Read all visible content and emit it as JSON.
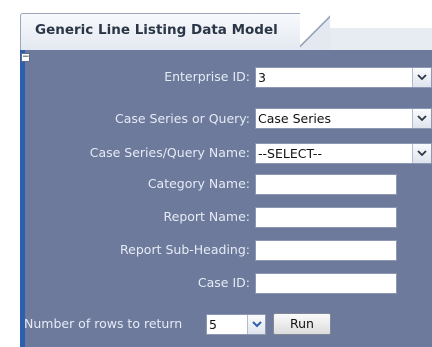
{
  "tab": {
    "title": "Generic Line Listing Data Model"
  },
  "collapse_toggle": "−",
  "fields": {
    "enterprise_id": {
      "label": "Enterprise ID:",
      "value": "3"
    },
    "case_series_or_query": {
      "label": "Case Series or Query:",
      "value": "Case Series"
    },
    "case_series_query_name": {
      "label": "Case Series/Query Name:",
      "value": "--SELECT--"
    },
    "category_name": {
      "label": "Category Name:",
      "value": ""
    },
    "report_name": {
      "label": "Report Name:",
      "value": ""
    },
    "report_sub_heading": {
      "label": "Report Sub-Heading:",
      "value": ""
    },
    "case_id": {
      "label": "Case ID:",
      "value": ""
    }
  },
  "rows_to_return": {
    "label": "Number of rows to return",
    "value": "5"
  },
  "run_button": {
    "label": "Run"
  },
  "colors": {
    "panel_bg": "#6e7a9b",
    "label_text": "#e5ebf6",
    "accent_bar": "#2e5fae"
  },
  "icons": {
    "dropdown": "chevron-down-icon",
    "collapse": "minus-icon"
  }
}
